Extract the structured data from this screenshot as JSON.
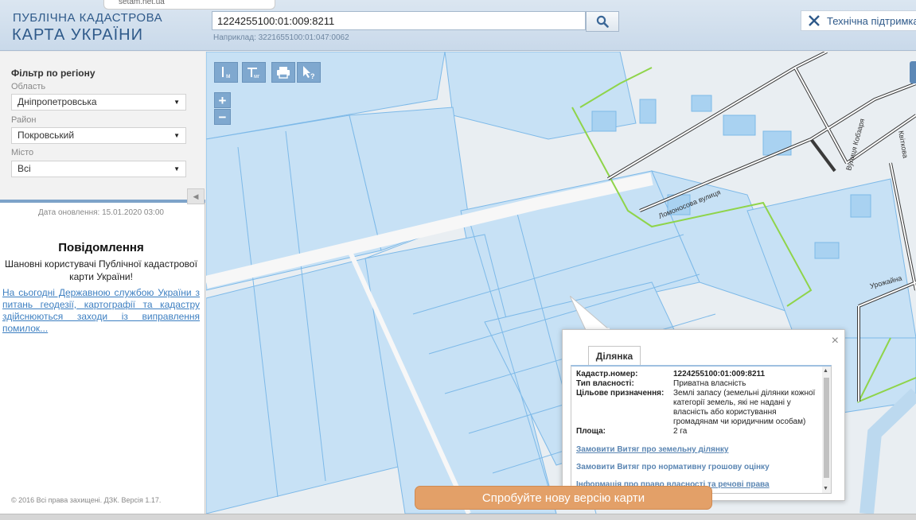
{
  "header": {
    "logo_line1": "ПУБЛІЧНА КАДАСТРОВА",
    "logo_line2": "КАРТА УКРАЇНИ",
    "popup_tip": "setam.net.ua",
    "search_value": "1224255100:01:009:8211",
    "search_hint": "Наприклад: 3221655100:01:047:0062",
    "tech_support_label": "Технічна підтримка"
  },
  "sidebar": {
    "filter_title": "Фільтр по регіону",
    "region_label": "Область",
    "region_value": "Дніпропетровська",
    "district_label": "Район",
    "district_value": "Покровський",
    "city_label": "Місто",
    "city_value": "Всі",
    "update_date": "Дата оновлення: 15.01.2020 03:00",
    "notice_title": "Повідомлення",
    "notice_text": "Шановні користувачі Публічної кадастрової карти України!",
    "notice_link": "На сьогодні Державною службою України з питань геодезії, картографії та кадастру здійснюються заходи із виправлення помилок...",
    "footer": "© 2016 Всі права захищені. ДЗК. Версія 1.17."
  },
  "map": {
    "tool_scale_m": "м",
    "tool_scale_mp": "мг",
    "zoom_in": "+",
    "zoom_out": "−",
    "streets": [
      "Ломоносова вулиця",
      "Вулиця Кобзаря",
      "Квіткова",
      "Урожайна"
    ],
    "try_new_version": "Спробуйте нову версію карти"
  },
  "parcel_popup": {
    "tab": "Ділянка",
    "close": "×",
    "fields": [
      {
        "k": "Кадастр.номер:",
        "v": "1224255100:01:009:8211"
      },
      {
        "k": "Тип власності:",
        "v": "Приватна власність"
      },
      {
        "k": "Цільове призначення:",
        "v": "Землі запасу (земельні ділянки кожної категорії земель, які не надані у власність або користування громадянам чи юридичним особам)"
      },
      {
        "k": "Площа:",
        "v": "2 га"
      }
    ],
    "link_extract": "Замовити Витяг про земельну ділянку",
    "link_valuation": "Замовити Витяг про нормативну грошову оцінку",
    "link_ownership": "Інформація про право власності та речові права"
  },
  "colors": {
    "parcel_fill": "#c7e1f5",
    "parcel_stroke": "#7db9e8",
    "road": "#f5f5f5",
    "boundary": "#8fd44a",
    "accent": "#e3a068"
  }
}
